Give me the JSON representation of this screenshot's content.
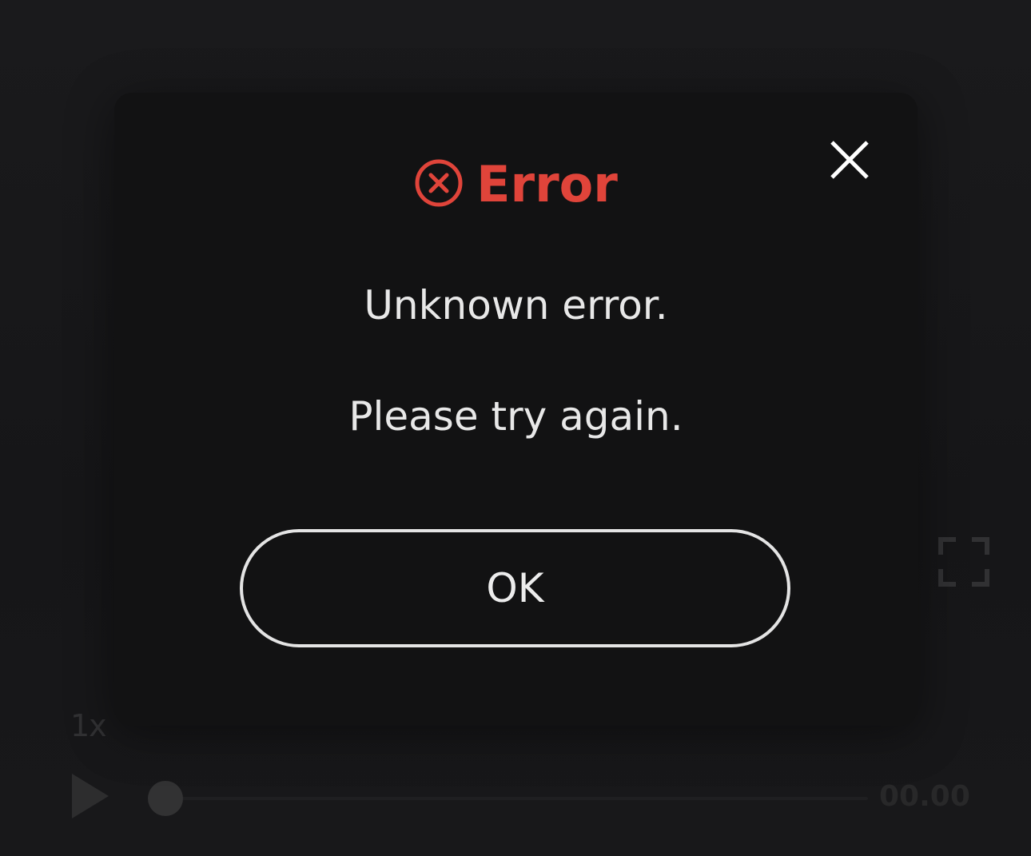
{
  "dialog": {
    "title": "Error",
    "message_line1": "Unknown error.",
    "message_line2": "Please try again.",
    "ok_label": "OK",
    "accent_color": "#e0443a",
    "icons": {
      "title_icon": "error-circle-x-icon",
      "close_icon": "close-icon"
    }
  },
  "player": {
    "speed": "1x",
    "time": "00.00",
    "progress": 0,
    "icons": {
      "play": "play-icon",
      "fullscreen": "fullscreen-icon"
    }
  }
}
